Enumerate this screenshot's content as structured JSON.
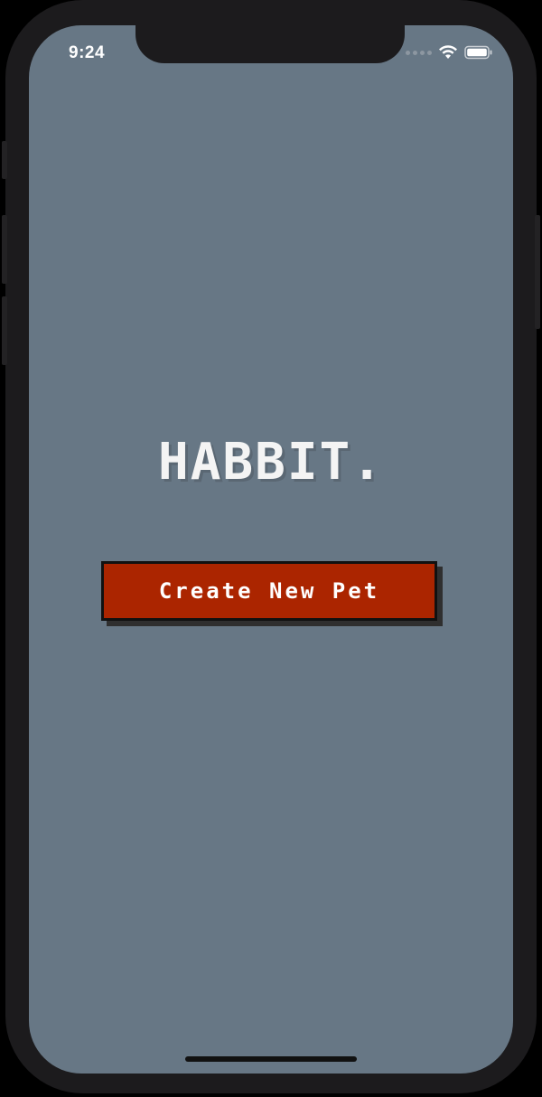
{
  "status_bar": {
    "time": "9:24",
    "icons": [
      "signal-dots-icon",
      "wifi-icon",
      "battery-icon"
    ]
  },
  "app": {
    "title": "HABBIT.",
    "create_button_label": "Create New Pet"
  },
  "colors": {
    "screen_background": "#677785",
    "button_background": "#ab2500",
    "title_text": "#f4f4f4"
  }
}
